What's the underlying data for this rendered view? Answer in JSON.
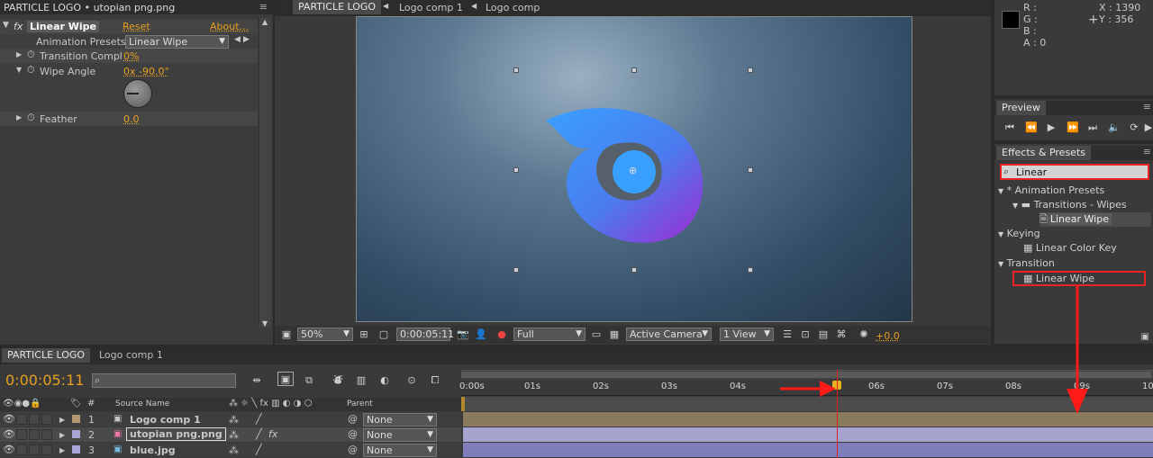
{
  "effect_controls": {
    "title": "PARTICLE LOGO • utopian png.png",
    "effect_name": "Linear Wipe",
    "reset": "Reset",
    "about": "About...",
    "presets_label": "Animation Presets:",
    "presets_value": "Linear Wipe",
    "prop1_label": "Transition Compl",
    "prop1_value": "0%",
    "prop2_label": "Wipe Angle",
    "prop2_value": "0x -90.0°",
    "prop3_label": "Feather",
    "prop3_value": "0.0"
  },
  "comp_viewer": {
    "tabs": [
      "PARTICLE LOGO",
      "Logo comp 1",
      "Logo comp"
    ],
    "zoom": "50%",
    "timecode": "0:00:05:11",
    "resolution": "Full",
    "camera": "Active Camera",
    "views": "1 View",
    "exposure": "+0.0"
  },
  "info": {
    "r": "R :",
    "g": "G :",
    "b": "B :",
    "a": "A : 0",
    "x": "X : 1390",
    "y": "Y : 356"
  },
  "preview": {
    "title": "Preview"
  },
  "effects_presets": {
    "title": "Effects & Presets",
    "search_value": "Linear",
    "cat1": "* Animation Presets",
    "folder1": "Transitions - Wipes",
    "item1": "Linear Wipe",
    "cat2": "Keying",
    "item2": "Linear Color Key",
    "cat3": "Transition",
    "item3": "Linear Wipe"
  },
  "timeline": {
    "tabs": [
      "PARTICLE LOGO",
      "Logo comp 1"
    ],
    "timecode": "0:00:05:11",
    "col_source": "Source Name",
    "col_parent": "Parent",
    "ruler": [
      "0:00s",
      "01s",
      "02s",
      "03s",
      "04s",
      "06s",
      "07s",
      "08s",
      "09s",
      "10"
    ],
    "layers": [
      {
        "num": "1",
        "name": "Logo comp 1",
        "parent": "None"
      },
      {
        "num": "2",
        "name": "utopian png.png",
        "parent": "None"
      },
      {
        "num": "3",
        "name": "blue.jpg",
        "parent": "None"
      }
    ]
  },
  "colors": {
    "accent": "#e6a020",
    "annotation": "#ff1a1a",
    "logo_blue": "#3aa0ff",
    "logo_purple": "#9a3ad6"
  }
}
